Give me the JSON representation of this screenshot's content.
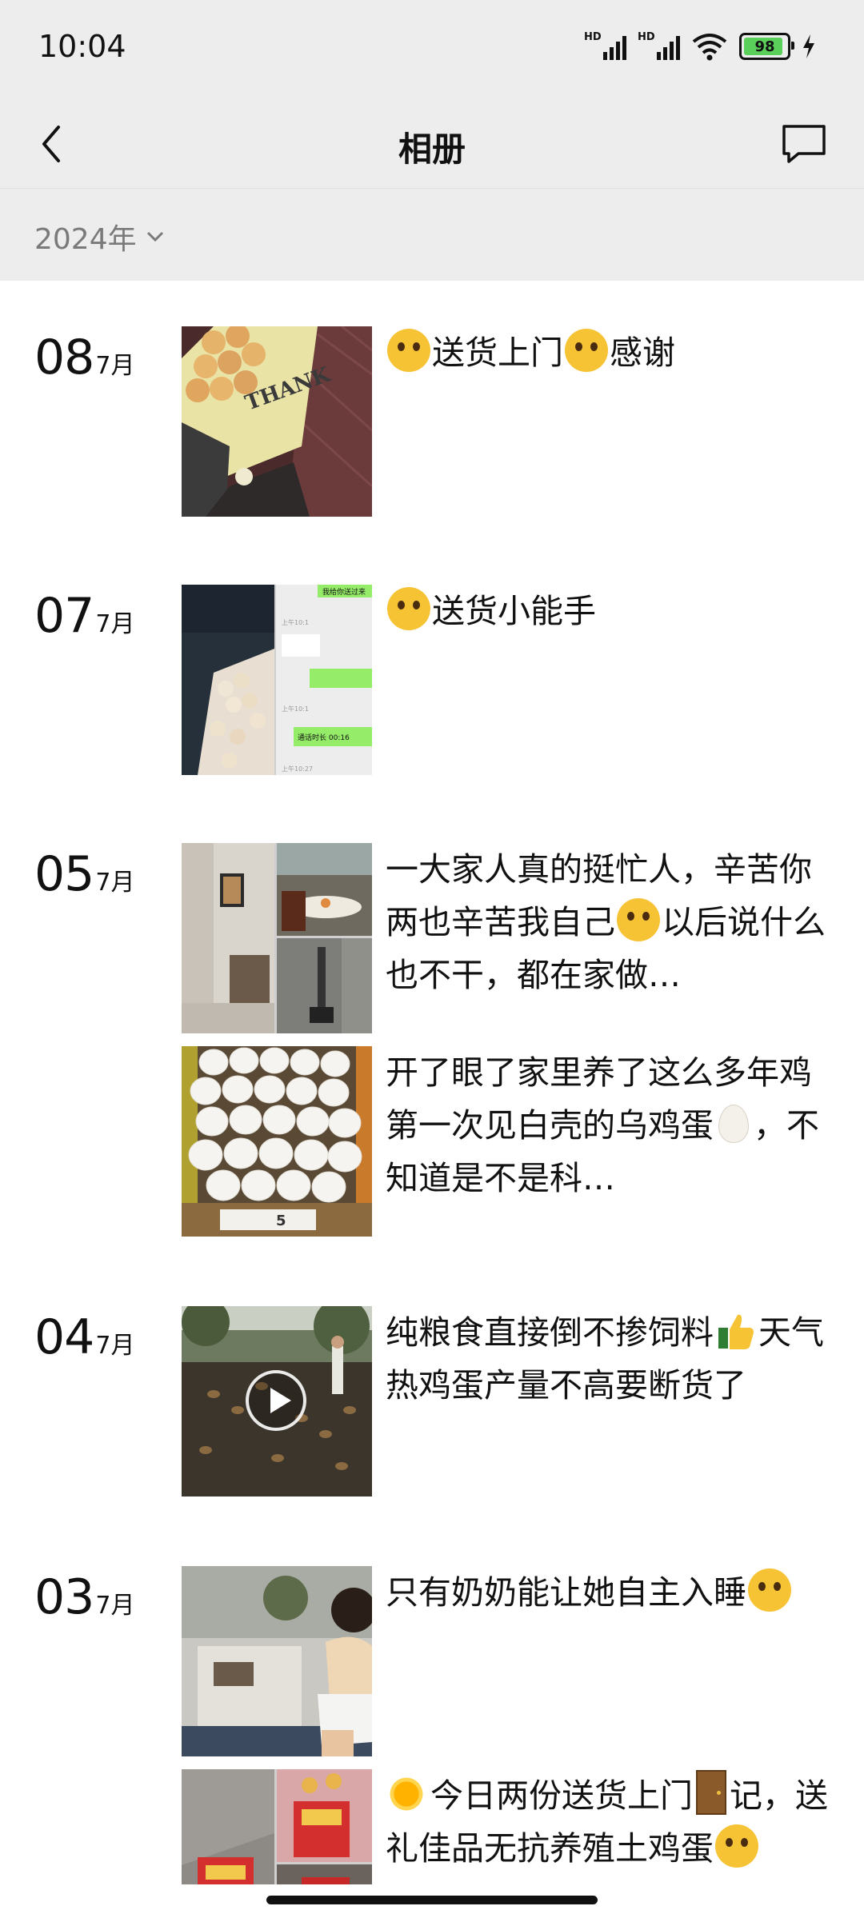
{
  "status_bar": {
    "time": "10:04",
    "signal1": "HD",
    "signal2": "HD",
    "battery": "98",
    "wifi_icon": "wifi-icon",
    "charging_icon": "bolt-icon"
  },
  "nav": {
    "title": "相册",
    "back_icon": "chevron-left-icon",
    "message_icon": "chat-bubble-icon"
  },
  "filter": {
    "year": "2024年",
    "dropdown_icon": "chevron-down-icon"
  },
  "posts": [
    {
      "day": "08",
      "month": "7月",
      "caption_a": "送货上门",
      "caption_b": "感谢"
    },
    {
      "day": "07",
      "month": "7月",
      "caption": "送货小能手"
    },
    {
      "day": "05",
      "month": "7月",
      "caption1": "一大家人真的挺忙人，辛苦你两也辛苦我自己",
      "caption1_b": "以后说什么也不干，都在家做…",
      "caption2_a": "开了眼了家里养了这么多年鸡第一次见白壳的乌鸡蛋",
      "caption2_b": "，不知道是不是科…"
    },
    {
      "day": "04",
      "month": "7月",
      "caption_a": "纯粮食直接倒不掺饲料",
      "caption_b": "天气热鸡蛋产量不高要断货了"
    },
    {
      "day": "03",
      "month": "7月",
      "caption1": "只有奶奶能让她自主入睡",
      "caption2_a": "今日两份送货上门",
      "caption2_b": "记，送礼佳品无抗养殖土鸡蛋"
    }
  ],
  "thumb_labels": {
    "bag_text": "THANK",
    "chat1": "我给你送过来",
    "chat2": "通话时长 00:16",
    "chat_time1": "上午10:1",
    "chat_time2": "上午10:27",
    "price_tag": "5"
  },
  "colors": {
    "bar_bg": "#ededed",
    "chat_green": "#95ec69",
    "emoji_yellow": "#f6c335"
  }
}
